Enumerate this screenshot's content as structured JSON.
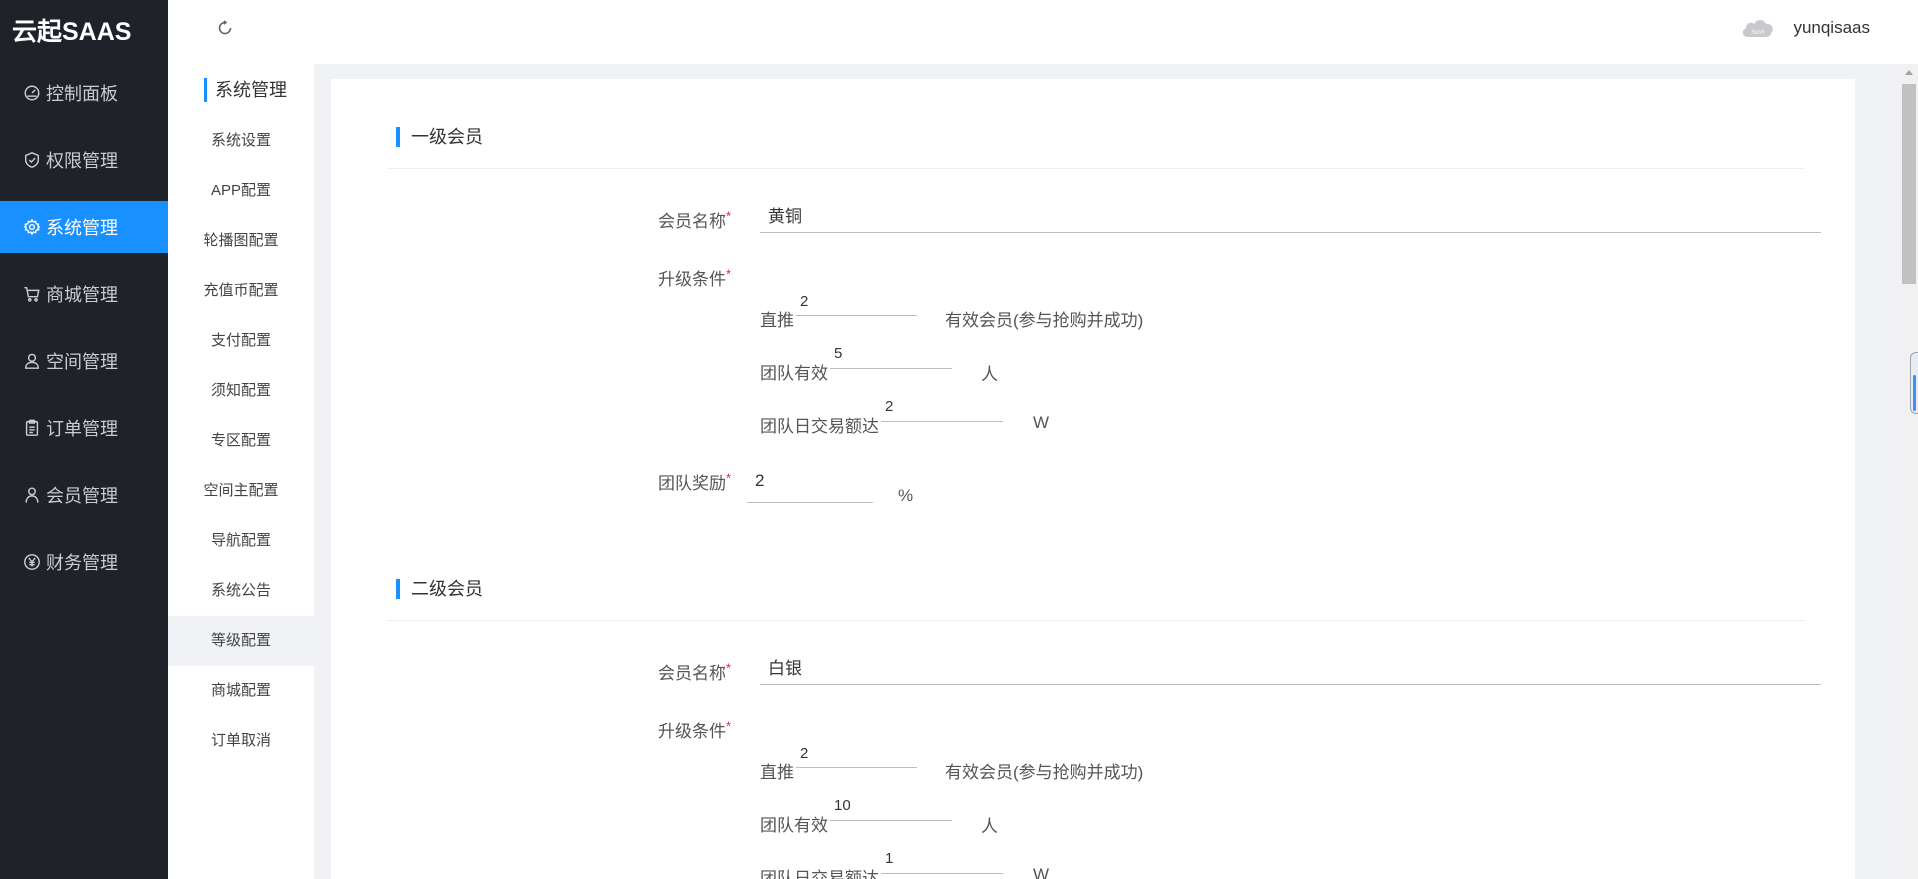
{
  "app": {
    "brand": "云起SAAS"
  },
  "nav": {
    "items": [
      {
        "label": "控制面板",
        "icon": "dashboard-icon"
      },
      {
        "label": "权限管理",
        "icon": "shield-check-icon"
      },
      {
        "label": "系统管理",
        "icon": "gear-icon",
        "active": true
      },
      {
        "label": "商城管理",
        "icon": "cart-icon"
      },
      {
        "label": "空间管理",
        "icon": "user-icon"
      },
      {
        "label": "订单管理",
        "icon": "clipboard-icon"
      },
      {
        "label": "会员管理",
        "icon": "person-icon"
      },
      {
        "label": "财务管理",
        "icon": "yen-icon"
      }
    ]
  },
  "header": {
    "username": "yunqisaas",
    "avatar_text": "SaaS"
  },
  "submenu": {
    "title": "系统管理",
    "items": [
      "系统设置",
      "APP配置",
      "轮播图配置",
      "充值币配置",
      "支付配置",
      "须知配置",
      "专区配置",
      "空间主配置",
      "导航配置",
      "系统公告",
      "等级配置",
      "商城配置",
      "订单取消"
    ],
    "active": "等级配置"
  },
  "labels": {
    "member_name": "会员名称",
    "upgrade": "升级条件",
    "reward": "团队奖励",
    "required_mark": "*",
    "direct": "直推",
    "team_valid": "团队有效",
    "team_daily": "团队日交易额达",
    "valid_members_suffix": "有效会员(参与抢购并成功)",
    "person_unit": "人",
    "w_unit": "W",
    "percent_unit": "%"
  },
  "levels": [
    {
      "title": "一级会员",
      "name": "黄铜",
      "direct": "2",
      "team_valid": "5",
      "team_daily": "2",
      "reward": "2"
    },
    {
      "title": "二级会员",
      "name": "白银",
      "direct": "2",
      "team_valid": "10",
      "team_daily": "1"
    }
  ],
  "colors": {
    "sidebar_bg": "#1f2229",
    "accent": "#1890ff",
    "required": "#f5222d"
  }
}
